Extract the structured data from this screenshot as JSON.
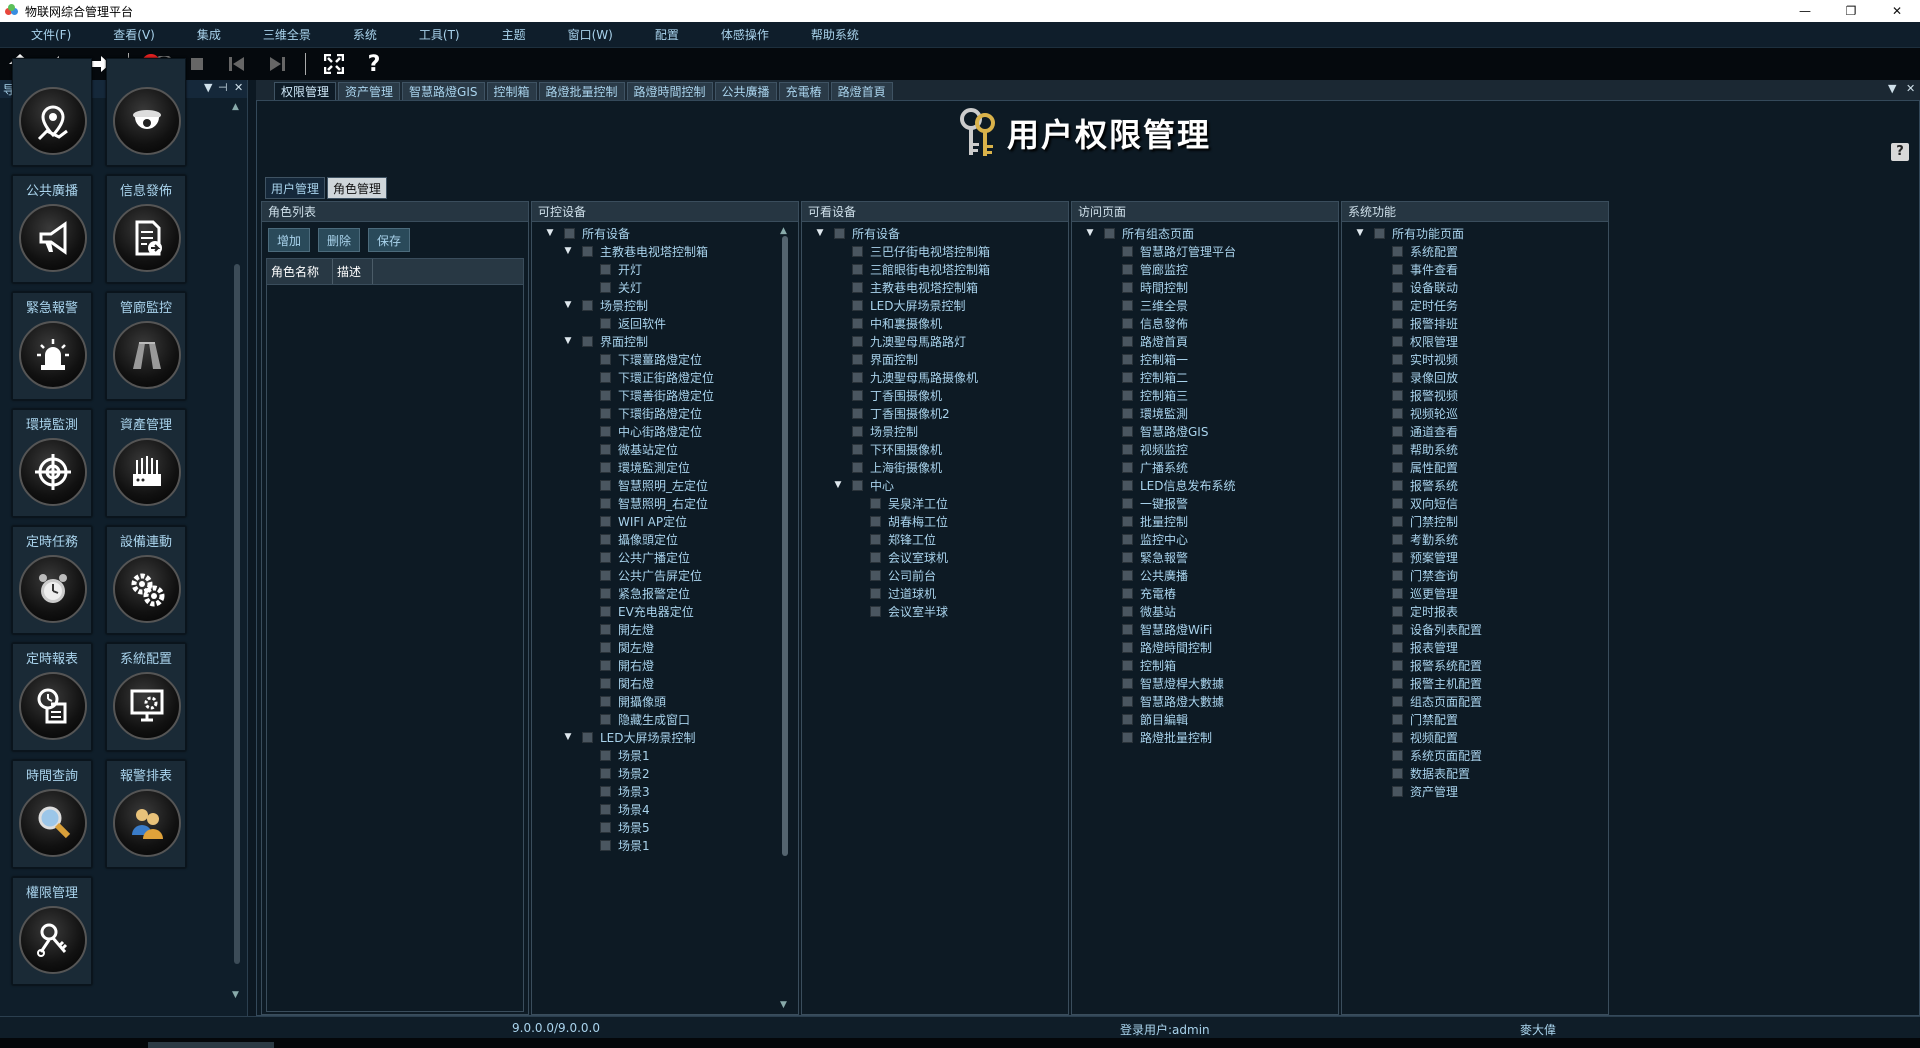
{
  "window": {
    "title": "物联网综合管理平台",
    "controls": [
      "—",
      "❐",
      "✕"
    ]
  },
  "menu": [
    "文件(F)",
    "查看(V)",
    "集成",
    "三维全景",
    "系统",
    "工具(T)",
    "主题",
    "窗口(W)",
    "配置",
    "体感操作",
    "帮助系统"
  ],
  "toolbar": {
    "badge": "0"
  },
  "nav_panel": {
    "title": "导航面板",
    "tiles": [
      {
        "label": "",
        "icon": "map-pin-icon"
      },
      {
        "label": "",
        "icon": "dome-camera-icon"
      },
      {
        "label": "公共廣播",
        "icon": "megaphone-icon"
      },
      {
        "label": "信息發佈",
        "icon": "document-share-icon"
      },
      {
        "label": "緊急報警",
        "icon": "alarm-light-icon"
      },
      {
        "label": "管廊監控",
        "icon": "tunnel-icon"
      },
      {
        "label": "環境監測",
        "icon": "crosshair-icon"
      },
      {
        "label": "資產管理",
        "icon": "server-assets-icon"
      },
      {
        "label": "定時任務",
        "icon": "alarm-clock-icon"
      },
      {
        "label": "設備連動",
        "icon": "gears-icon"
      },
      {
        "label": "定時報表",
        "icon": "clock-report-icon"
      },
      {
        "label": "系統配置",
        "icon": "monitor-gear-icon"
      },
      {
        "label": "時間查詢",
        "icon": "magnifier-icon"
      },
      {
        "label": "報警排表",
        "icon": "users-icon"
      },
      {
        "label": "權限管理",
        "icon": "keys-icon"
      }
    ]
  },
  "tabs": [
    "权限管理",
    "资产管理",
    "智慧路燈GIS",
    "控制箱",
    "路燈批量控制",
    "路燈時間控制",
    "公共廣播",
    "充電樁",
    "路燈首頁"
  ],
  "heading": "用户权限管理",
  "help": "?",
  "subtabs": [
    "用户管理",
    "角色管理"
  ],
  "role_panel": {
    "title": "角色列表",
    "buttons": [
      "增加",
      "删除",
      "保存"
    ],
    "columns": [
      "角色名称",
      "描述"
    ]
  },
  "controllable_panel": {
    "title": "可控设备",
    "tree": [
      {
        "t": "所有设备",
        "lv": 0,
        "exp": true
      },
      {
        "t": "主教巷电视塔控制箱",
        "lv": 1,
        "exp": true
      },
      {
        "t": "开灯",
        "lv": 2
      },
      {
        "t": "关灯",
        "lv": 2
      },
      {
        "t": "场景控制",
        "lv": 1,
        "exp": true
      },
      {
        "t": "返回软件",
        "lv": 2
      },
      {
        "t": "界面控制",
        "lv": 1,
        "exp": true
      },
      {
        "t": "下環薑路燈定位",
        "lv": 2
      },
      {
        "t": "下環正街路燈定位",
        "lv": 2
      },
      {
        "t": "下環善街路燈定位",
        "lv": 2
      },
      {
        "t": "下環街路燈定位",
        "lv": 2
      },
      {
        "t": "中心街路燈定位",
        "lv": 2
      },
      {
        "t": "微基站定位",
        "lv": 2
      },
      {
        "t": "環境監測定位",
        "lv": 2
      },
      {
        "t": "智慧照明_左定位",
        "lv": 2
      },
      {
        "t": "智慧照明_右定位",
        "lv": 2
      },
      {
        "t": "WIFI AP定位",
        "lv": 2
      },
      {
        "t": "攝像頭定位",
        "lv": 2
      },
      {
        "t": "公共广播定位",
        "lv": 2
      },
      {
        "t": "公共广告屏定位",
        "lv": 2
      },
      {
        "t": "紧急报警定位",
        "lv": 2
      },
      {
        "t": "EV充电器定位",
        "lv": 2
      },
      {
        "t": "開左燈",
        "lv": 2
      },
      {
        "t": "関左燈",
        "lv": 2
      },
      {
        "t": "開右燈",
        "lv": 2
      },
      {
        "t": "関右燈",
        "lv": 2
      },
      {
        "t": "開攝像頭",
        "lv": 2
      },
      {
        "t": "隐藏生成窗口",
        "lv": 2
      },
      {
        "t": "LED大屏场景控制",
        "lv": 1,
        "exp": true
      },
      {
        "t": "场景1",
        "lv": 2
      },
      {
        "t": "场景2",
        "lv": 2
      },
      {
        "t": "场景3",
        "lv": 2
      },
      {
        "t": "场景4",
        "lv": 2
      },
      {
        "t": "场景5",
        "lv": 2
      },
      {
        "t": "场景1",
        "lv": 2
      }
    ]
  },
  "visible_panel": {
    "title": "可看设备",
    "tree": [
      {
        "t": "所有设备",
        "lv": 0,
        "exp": true
      },
      {
        "t": "三巴仔街电视塔控制箱",
        "lv": 1
      },
      {
        "t": "三館眼街电视塔控制箱",
        "lv": 1
      },
      {
        "t": "主教巷电视塔控制箱",
        "lv": 1
      },
      {
        "t": "LED大屏场景控制",
        "lv": 1
      },
      {
        "t": "中和裏摄像机",
        "lv": 1
      },
      {
        "t": "九澳聖母馬路路灯",
        "lv": 1
      },
      {
        "t": "界面控制",
        "lv": 1
      },
      {
        "t": "九澳聖母馬路摄像机",
        "lv": 1
      },
      {
        "t": "丁香围摄像机",
        "lv": 1
      },
      {
        "t": "丁香围摄像机2",
        "lv": 1
      },
      {
        "t": "场景控制",
        "lv": 1
      },
      {
        "t": "下环围摄像机",
        "lv": 1
      },
      {
        "t": "上海街摄像机",
        "lv": 1
      },
      {
        "t": "中心",
        "lv": 1,
        "exp": true
      },
      {
        "t": "吴泉洋工位",
        "lv": 2
      },
      {
        "t": "胡春梅工位",
        "lv": 2
      },
      {
        "t": "郑锋工位",
        "lv": 2
      },
      {
        "t": "会议室球机",
        "lv": 2
      },
      {
        "t": "公司前台",
        "lv": 2
      },
      {
        "t": "过道球机",
        "lv": 2
      },
      {
        "t": "会议室半球",
        "lv": 2
      }
    ]
  },
  "pages_panel": {
    "title": "访问页面",
    "tree": [
      {
        "t": "所有组态页面",
        "lv": 0,
        "exp": true
      },
      {
        "t": "智慧路灯管理平台",
        "lv": 1
      },
      {
        "t": "管廊监控",
        "lv": 1
      },
      {
        "t": "時間控制",
        "lv": 1
      },
      {
        "t": "三维全景",
        "lv": 1
      },
      {
        "t": "信息發佈",
        "lv": 1
      },
      {
        "t": "路燈首頁",
        "lv": 1
      },
      {
        "t": "控制箱一",
        "lv": 1
      },
      {
        "t": "控制箱二",
        "lv": 1
      },
      {
        "t": "控制箱三",
        "lv": 1
      },
      {
        "t": "環境監測",
        "lv": 1
      },
      {
        "t": "智慧路燈GIS",
        "lv": 1
      },
      {
        "t": "视频监控",
        "lv": 1
      },
      {
        "t": "广播系统",
        "lv": 1
      },
      {
        "t": "LED信息发布系统",
        "lv": 1
      },
      {
        "t": "一键报警",
        "lv": 1
      },
      {
        "t": "批量控制",
        "lv": 1
      },
      {
        "t": "监控中心",
        "lv": 1
      },
      {
        "t": "緊急報警",
        "lv": 1
      },
      {
        "t": "公共廣播",
        "lv": 1
      },
      {
        "t": "充電樁",
        "lv": 1
      },
      {
        "t": "微基站",
        "lv": 1
      },
      {
        "t": "智慧路燈WiFi",
        "lv": 1
      },
      {
        "t": "路燈時間控制",
        "lv": 1
      },
      {
        "t": "控制箱",
        "lv": 1
      },
      {
        "t": "智慧燈桿大數據",
        "lv": 1
      },
      {
        "t": "智慧路燈大數據",
        "lv": 1
      },
      {
        "t": "節目編輯",
        "lv": 1
      },
      {
        "t": "路燈批量控制",
        "lv": 1
      }
    ]
  },
  "functions_panel": {
    "title": "系统功能",
    "tree": [
      {
        "t": "所有功能页面",
        "lv": 0,
        "exp": true
      },
      {
        "t": "系统配置",
        "lv": 1
      },
      {
        "t": "事件查看",
        "lv": 1
      },
      {
        "t": "设备联动",
        "lv": 1
      },
      {
        "t": "定时任务",
        "lv": 1
      },
      {
        "t": "报警排班",
        "lv": 1
      },
      {
        "t": "权限管理",
        "lv": 1
      },
      {
        "t": "实时视频",
        "lv": 1
      },
      {
        "t": "录像回放",
        "lv": 1
      },
      {
        "t": "报警视频",
        "lv": 1
      },
      {
        "t": "视频轮巡",
        "lv": 1
      },
      {
        "t": "通道查看",
        "lv": 1
      },
      {
        "t": "帮助系统",
        "lv": 1
      },
      {
        "t": "属性配置",
        "lv": 1
      },
      {
        "t": "报警系统",
        "lv": 1
      },
      {
        "t": "双向短信",
        "lv": 1
      },
      {
        "t": "门禁控制",
        "lv": 1
      },
      {
        "t": "考勤系统",
        "lv": 1
      },
      {
        "t": "预案管理",
        "lv": 1
      },
      {
        "t": "门禁查询",
        "lv": 1
      },
      {
        "t": "巡更管理",
        "lv": 1
      },
      {
        "t": "定时报表",
        "lv": 1
      },
      {
        "t": "设备列表配置",
        "lv": 1
      },
      {
        "t": "报表管理",
        "lv": 1
      },
      {
        "t": "报警系统配置",
        "lv": 1
      },
      {
        "t": "报警主机配置",
        "lv": 1
      },
      {
        "t": "组态页面配置",
        "lv": 1
      },
      {
        "t": "门禁配置",
        "lv": 1
      },
      {
        "t": "视频配置",
        "lv": 1
      },
      {
        "t": "系统页面配置",
        "lv": 1
      },
      {
        "t": "数据表配置",
        "lv": 1
      },
      {
        "t": "资产管理",
        "lv": 1
      }
    ]
  },
  "status": {
    "version": "9.0.0.0/9.0.0.0",
    "user": "登录用户:admin",
    "operator": "麥大偉"
  }
}
